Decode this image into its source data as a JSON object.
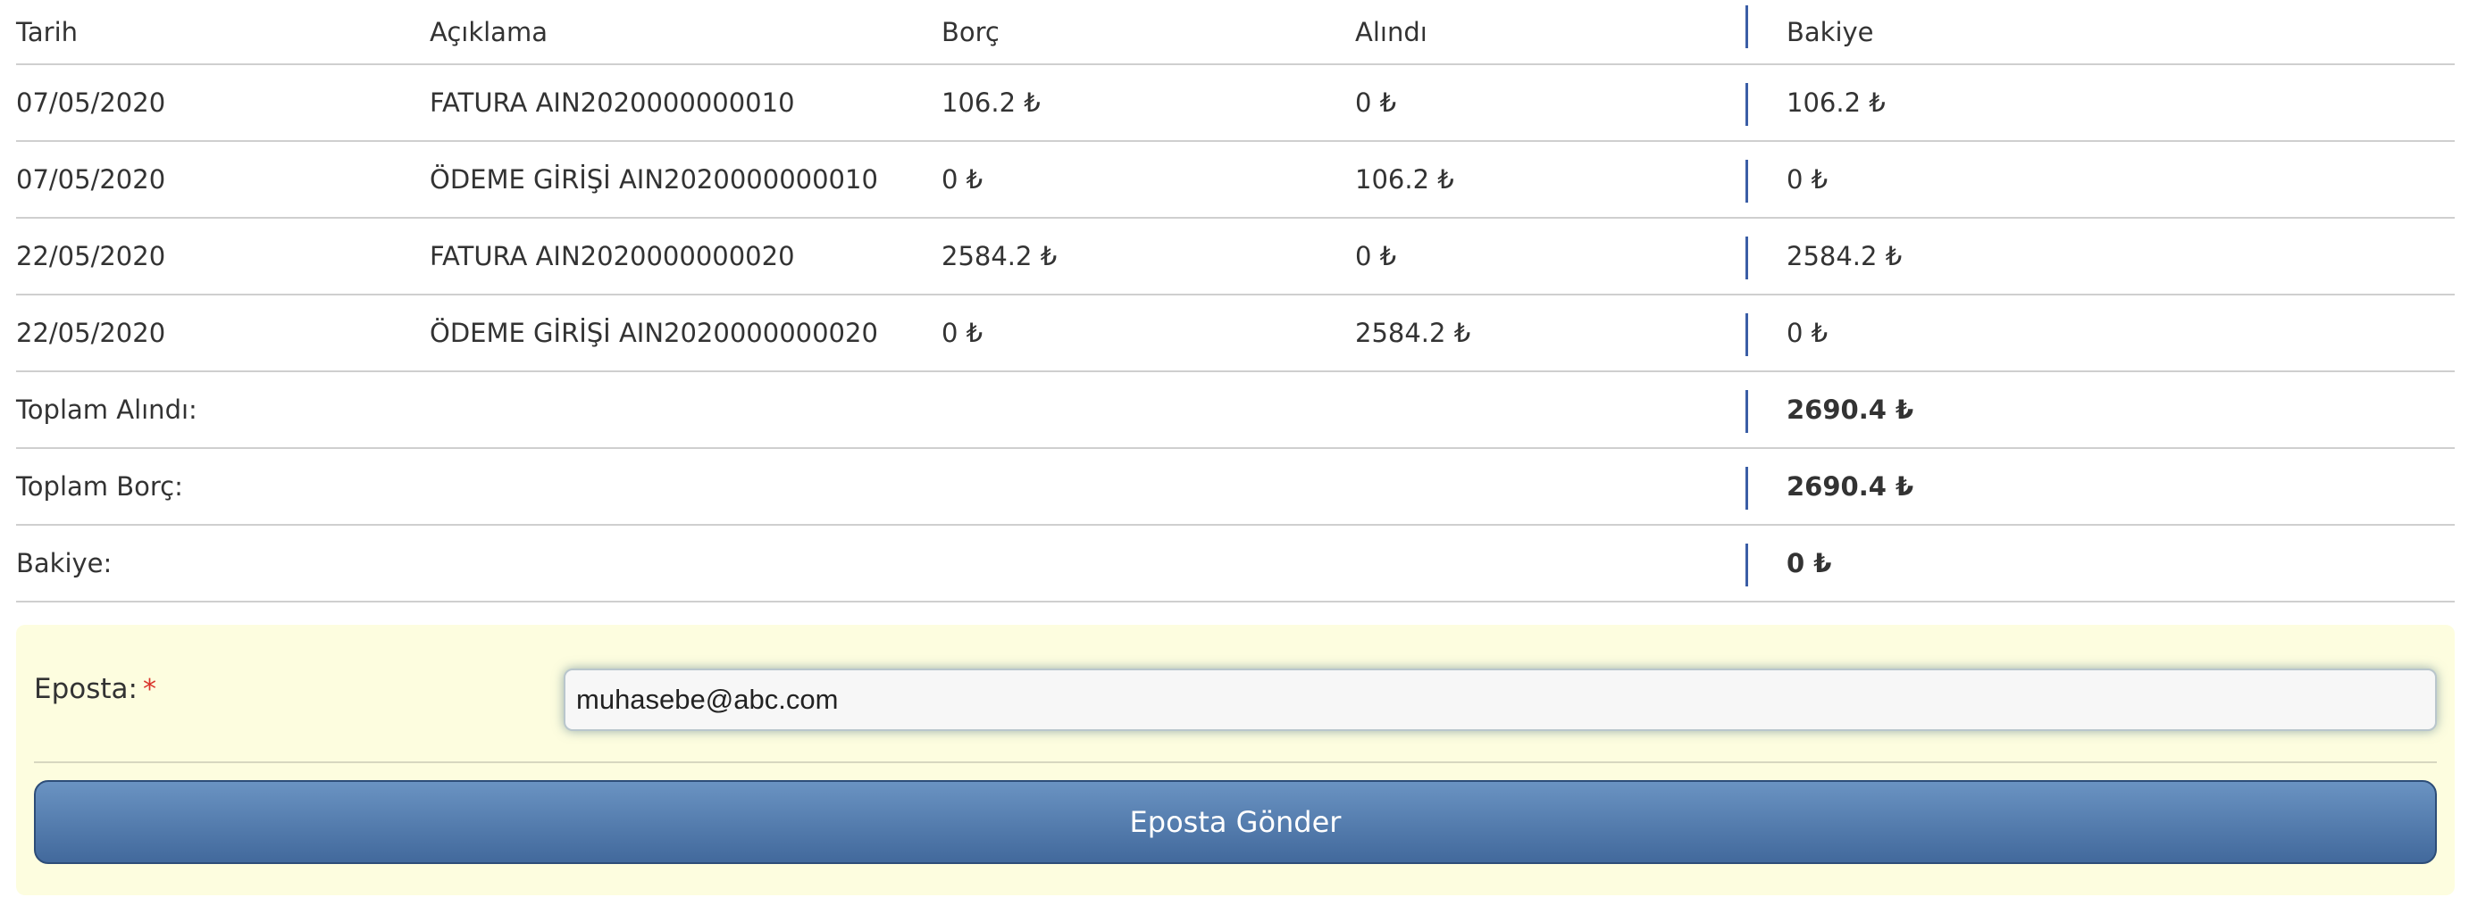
{
  "table": {
    "headers": {
      "date": "Tarih",
      "description": "Açıklama",
      "debt": "Borç",
      "received": "Alındı",
      "balance": "Bakiye"
    },
    "rows": [
      {
        "date": "07/05/2020",
        "description": "FATURA AIN2020000000010",
        "debt": "106.2 ₺",
        "received": "0 ₺",
        "balance": "106.2 ₺"
      },
      {
        "date": "07/05/2020",
        "description": "ÖDEME GİRİŞİ AIN2020000000010",
        "debt": "0 ₺",
        "received": "106.2 ₺",
        "balance": "0 ₺"
      },
      {
        "date": "22/05/2020",
        "description": "FATURA AIN2020000000020",
        "debt": "2584.2 ₺",
        "received": "0 ₺",
        "balance": "2584.2 ₺"
      },
      {
        "date": "22/05/2020",
        "description": "ÖDEME GİRİŞİ AIN2020000000020",
        "debt": "0 ₺",
        "received": "2584.2 ₺",
        "balance": "0 ₺"
      }
    ],
    "summary": [
      {
        "label": "Toplam Alındı:",
        "value": "2690.4 ₺"
      },
      {
        "label": "Toplam Borç:",
        "value": "2690.4 ₺"
      },
      {
        "label": "Bakiye:",
        "value": "0 ₺"
      }
    ]
  },
  "form": {
    "email_label": "Eposta:",
    "required_mark": "*",
    "email_value": "muhasebe@abc.com",
    "send_label": "Eposta Gönder"
  },
  "colors": {
    "panel_background": "#fdfddf",
    "button_gradient_top": "#6a93c2",
    "button_gradient_bottom": "#42699c",
    "divider_accent": "#3b5ea6",
    "required_color": "#d9342b"
  }
}
